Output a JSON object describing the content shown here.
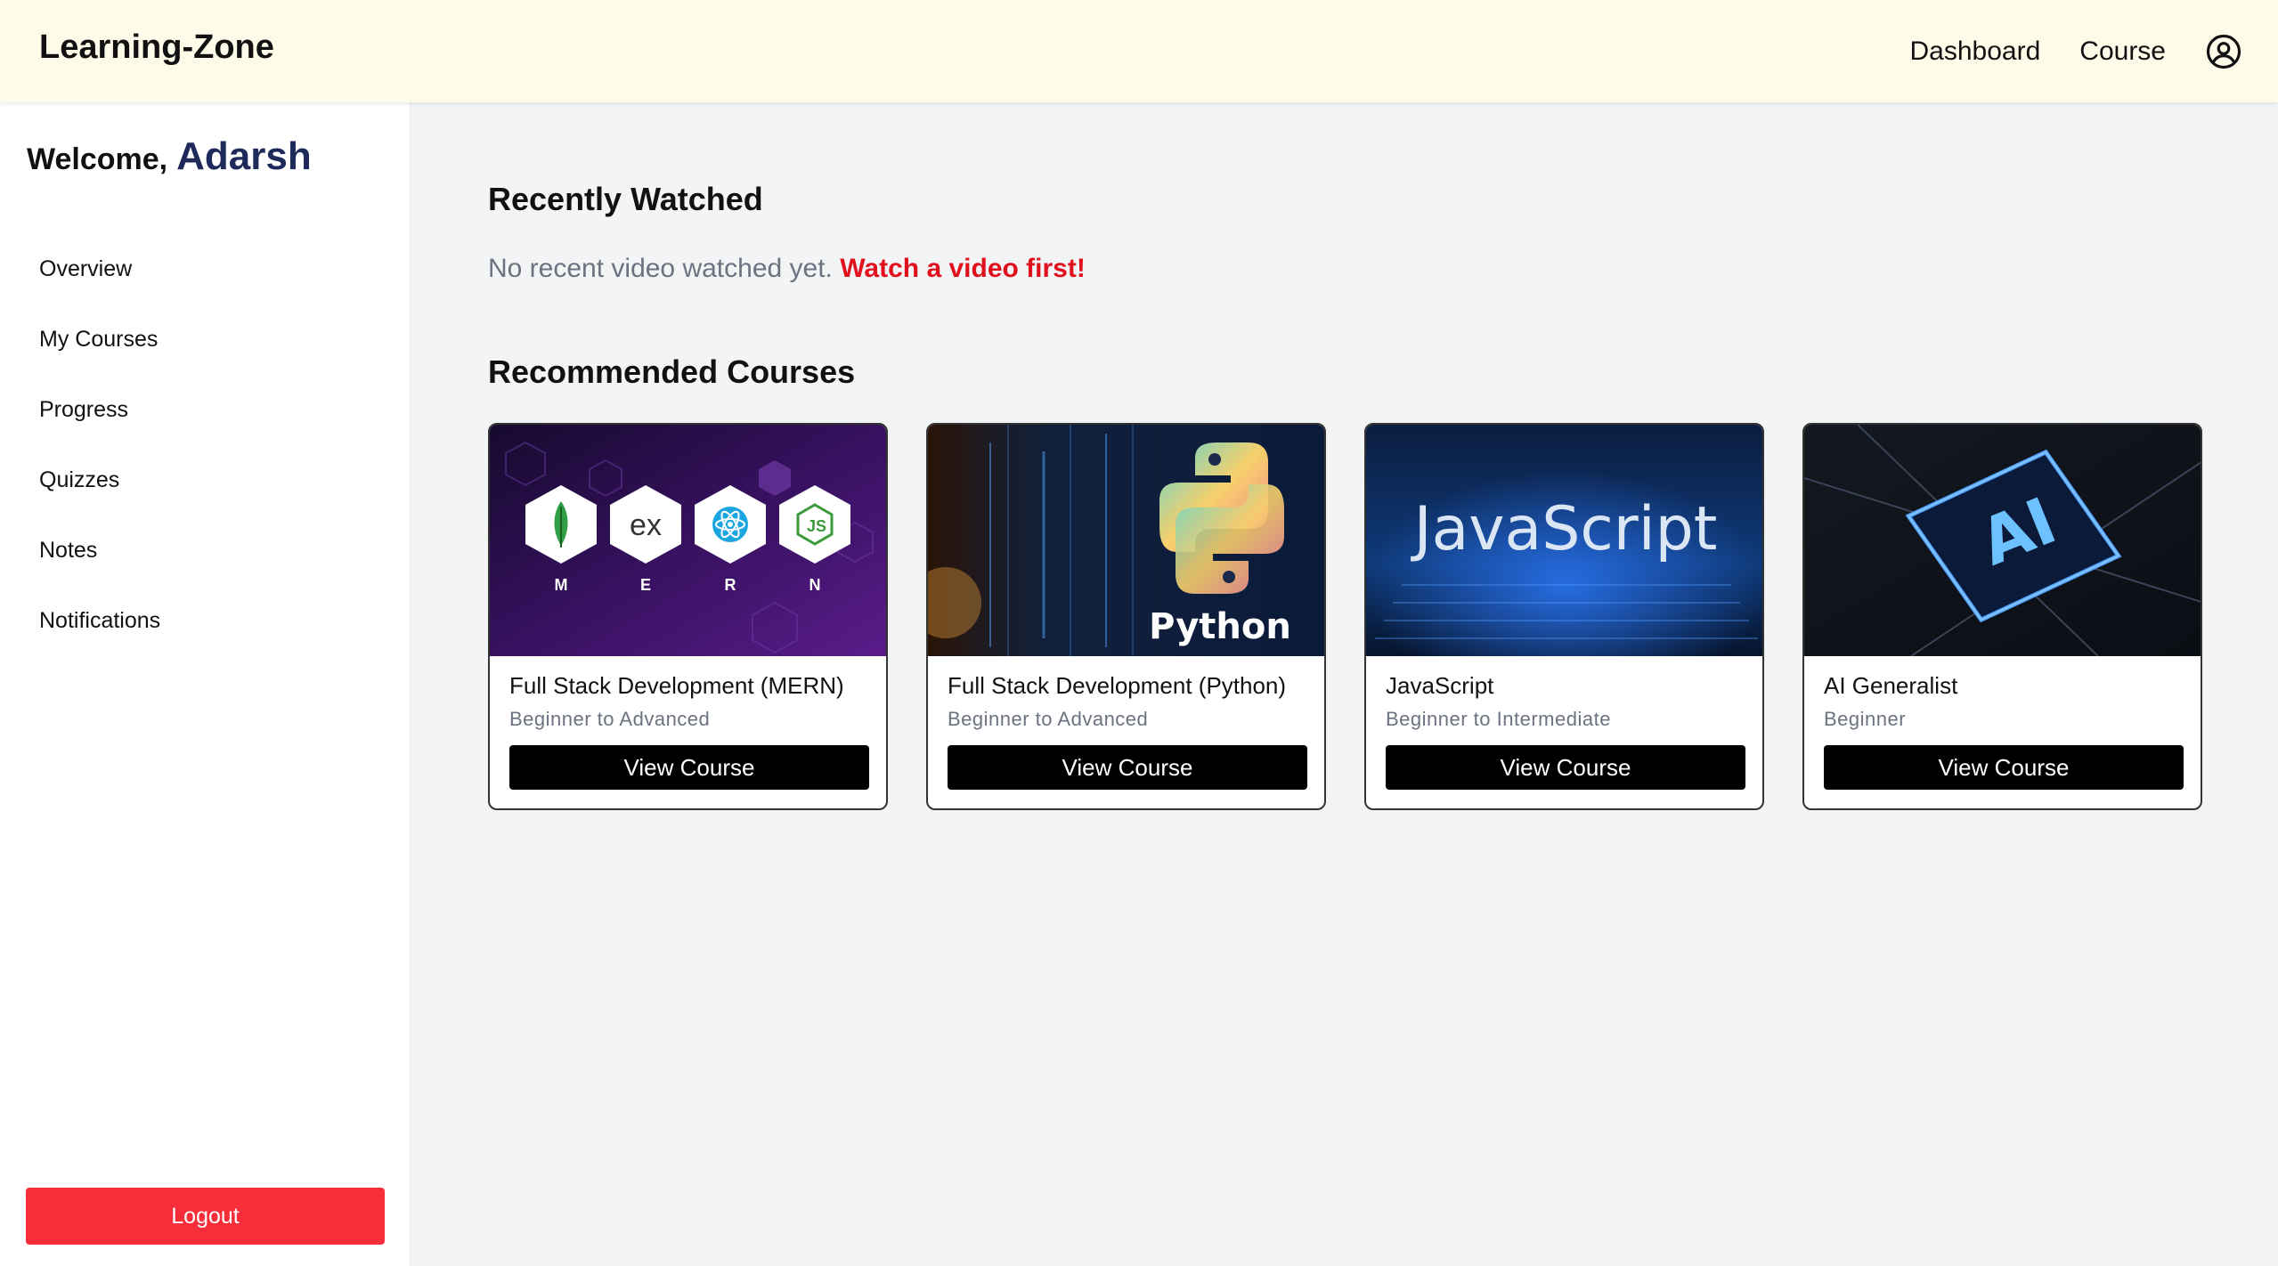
{
  "header": {
    "brand": "Learning-Zone",
    "nav": {
      "dashboard": "Dashboard",
      "course": "Course"
    },
    "user_icon": "user-circle-icon"
  },
  "sidebar": {
    "welcome_prefix": "Welcome,",
    "user_name": "Adarsh",
    "items": [
      {
        "label": "Overview"
      },
      {
        "label": "My Courses"
      },
      {
        "label": "Progress"
      },
      {
        "label": "Quizzes"
      },
      {
        "label": "Notes"
      },
      {
        "label": "Notifications"
      }
    ],
    "logout_label": "Logout"
  },
  "main": {
    "recent": {
      "title": "Recently Watched",
      "empty_text": "No recent video watched yet.",
      "cta": "Watch a video first!"
    },
    "recommended": {
      "title": "Recommended Courses",
      "courses": [
        {
          "title": "Full Stack Development (MERN)",
          "level": "Beginner to Advanced",
          "button": "View Course",
          "thumb_letters": [
            "M",
            "E",
            "R",
            "N"
          ],
          "thumb_ex": "ex"
        },
        {
          "title": "Full Stack Development (Python)",
          "level": "Beginner to Advanced",
          "button": "View Course",
          "thumb_text": "Python"
        },
        {
          "title": "JavaScript",
          "level": "Beginner to Intermediate",
          "button": "View Course",
          "thumb_text": "JavaScript"
        },
        {
          "title": "AI Generalist",
          "level": "Beginner",
          "button": "View Course",
          "thumb_text": "AI"
        }
      ]
    }
  },
  "colors": {
    "header_bg": "#fefbe8",
    "accent_red": "#e0101c",
    "logout_red": "#f72d3a",
    "button_black": "#000000",
    "user_name": "#1e2a5a"
  }
}
